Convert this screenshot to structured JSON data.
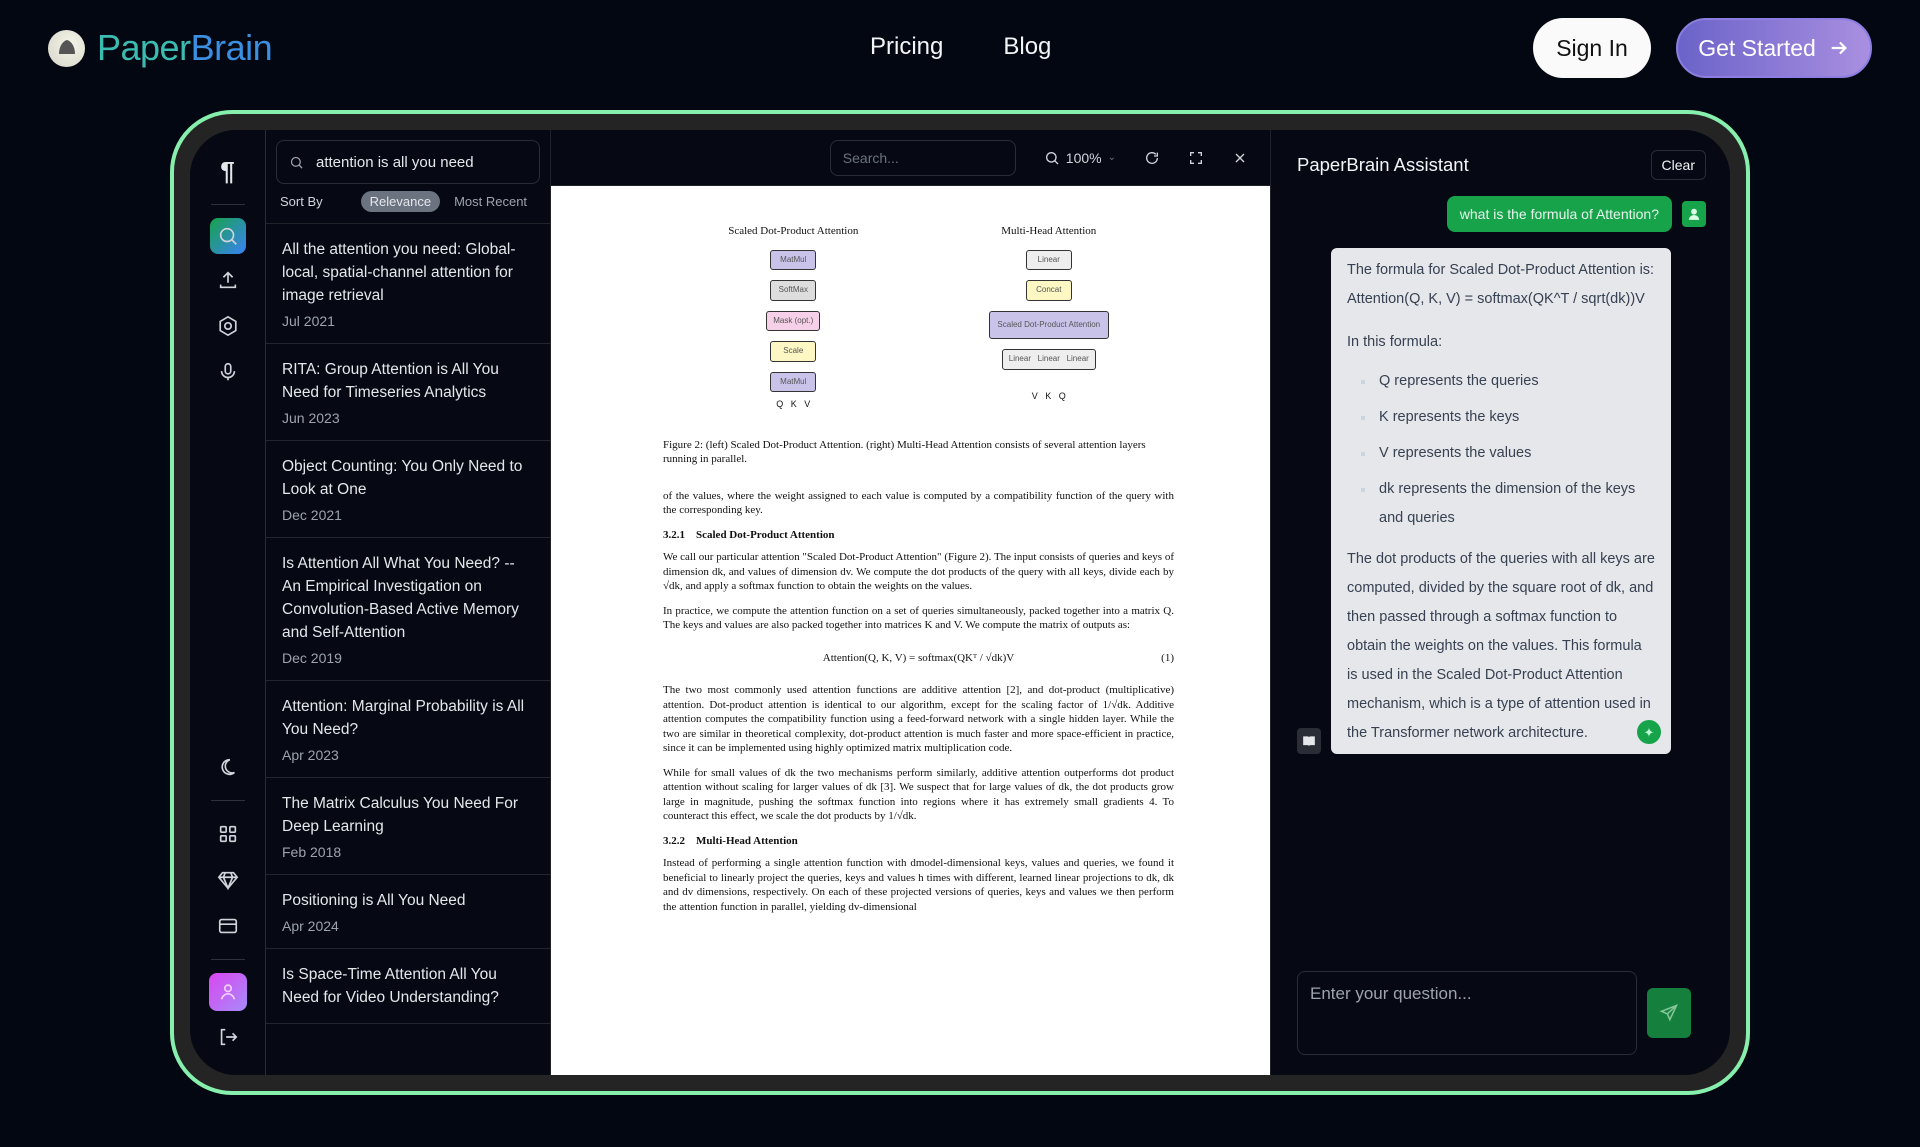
{
  "header": {
    "brand_part1": "Paper",
    "brand_part2": "Brain",
    "nav": [
      "Pricing",
      "Blog"
    ],
    "sign_in": "Sign In",
    "get_started": "Get Started"
  },
  "search": {
    "query": "attention is all you need",
    "sort_label": "Sort By",
    "sort_options": [
      "Relevance",
      "Most Recent"
    ],
    "sort_selected": "Relevance"
  },
  "results": [
    {
      "title": "All the attention you need: Global-local, spatial-channel attention for image retrieval",
      "date": "Jul 2021"
    },
    {
      "title": "RITA: Group Attention is All You Need for Timeseries Analytics",
      "date": "Jun 2023"
    },
    {
      "title": "Object Counting: You Only Need to Look at One",
      "date": "Dec 2021"
    },
    {
      "title": "Is Attention All What You Need? -- An Empirical Investigation on Convolution-Based Active Memory and Self-Attention",
      "date": "Dec 2019"
    },
    {
      "title": "Attention: Marginal Probability is All You Need?",
      "date": "Apr 2023"
    },
    {
      "title": "The Matrix Calculus You Need For Deep Learning",
      "date": "Feb 2018"
    },
    {
      "title": "Positioning is All You Need",
      "date": "Apr 2024"
    },
    {
      "title": "Is Space-Time Attention All You Need for Video Understanding?",
      "date": ""
    }
  ],
  "viewer": {
    "search_placeholder": "Search...",
    "zoom": "100%"
  },
  "paper": {
    "fig_left_title": "Scaled Dot-Product Attention",
    "fig_left_boxes": [
      "MatMul",
      "SoftMax",
      "Mask (opt.)",
      "Scale",
      "MatMul"
    ],
    "fig_left_inputs": "Q   K   V",
    "fig_right_title": "Multi-Head Attention",
    "fig_right_boxes": [
      "Linear",
      "Concat",
      "Scaled Dot-Product Attention",
      "Linear   Linear   Linear"
    ],
    "fig_right_inputs": "V   K   Q",
    "caption": "Figure 2: (left) Scaled Dot-Product Attention. (right) Multi-Head Attention consists of several attention layers running in parallel.",
    "p1": "of the values, where the weight assigned to each value is computed by a compatibility function of the query with the corresponding key.",
    "h321": "3.2.1    Scaled Dot-Product Attention",
    "p2": "We call our particular attention \"Scaled Dot-Product Attention\" (Figure 2). The input consists of queries and keys of dimension dk, and values of dimension dv. We compute the dot products of the query with all keys, divide each by √dk, and apply a softmax function to obtain the weights on the values.",
    "p3": "In practice, we compute the attention function on a set of queries simultaneously, packed together into a matrix Q. The keys and values are also packed together into matrices K and V. We compute the matrix of outputs as:",
    "equation": "Attention(Q, K, V) = softmax(QKᵀ / √dk)V",
    "eq_number": "(1)",
    "p4": "The two most commonly used attention functions are additive attention [2], and dot-product (multiplicative) attention. Dot-product attention is identical to our algorithm, except for the scaling factor of 1/√dk. Additive attention computes the compatibility function using a feed-forward network with a single hidden layer. While the two are similar in theoretical complexity, dot-product attention is much faster and more space-efficient in practice, since it can be implemented using highly optimized matrix multiplication code.",
    "p5": "While for small values of dk the two mechanisms perform similarly, additive attention outperforms dot product attention without scaling for larger values of dk [3]. We suspect that for large values of dk, the dot products grow large in magnitude, pushing the softmax function into regions where it has extremely small gradients 4. To counteract this effect, we scale the dot products by 1/√dk.",
    "h322": "3.2.2    Multi-Head Attention",
    "p6": "Instead of performing a single attention function with dmodel-dimensional keys, values and queries, we found it beneficial to linearly project the queries, keys and values h times with different, learned linear projections to dk, dk and dv dimensions, respectively. On each of these projected versions of queries, keys and values we then perform the attention function in parallel, yielding dv-dimensional"
  },
  "assistant": {
    "title": "PaperBrain Assistant",
    "clear": "Clear",
    "user_message": "what is the formula of Attention?",
    "reply_intro": "The formula for Scaled Dot-Product Attention is: Attention(Q, K, V) = softmax(QK^T / sqrt(dk))V",
    "reply_lead": "In this formula:",
    "reply_bullets": [
      "Q represents the queries",
      "K represents the keys",
      "V represents the values",
      "dk represents the dimension of the keys and queries"
    ],
    "reply_outro": "The dot products of the queries with all keys are computed, divided by the square root of dk, and then passed through a softmax function to obtain the weights on the values. This formula is used in the Scaled Dot-Product Attention mechanism, which is a type of attention used in the Transformer network architecture.",
    "input_placeholder": "Enter your question..."
  },
  "colors": {
    "accent_green": "#86efac",
    "brand_teal": "#3cbcb0",
    "brand_blue": "#3b8ee0",
    "cta_purple": "#8b7ee0",
    "chat_green": "#16a34a"
  }
}
